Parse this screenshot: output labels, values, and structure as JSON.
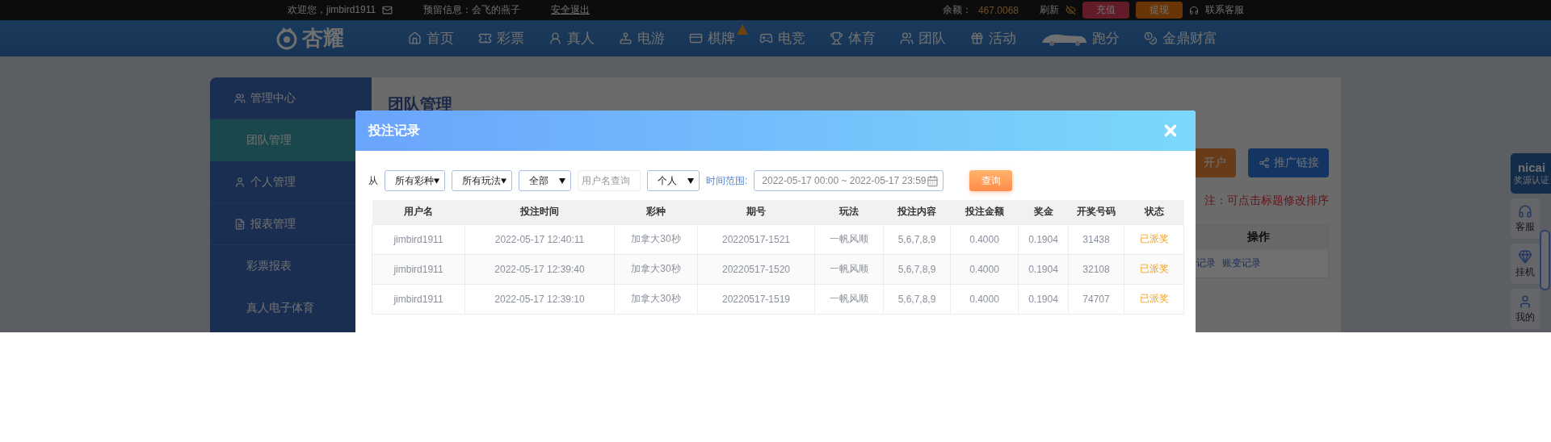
{
  "top_bar": {
    "welcome": "欢迎您，jimbird1911",
    "message": "预留信息：会飞的燕子",
    "logout": "安全退出",
    "balance_label": "余额：",
    "balance": "467.0068",
    "refresh": "刷新",
    "buttons": [
      {
        "label": "充值",
        "kind": "deposit"
      },
      {
        "label": "提现",
        "kind": "withdraw"
      }
    ],
    "support": "联系客服"
  },
  "nav": {
    "logo": "杏耀",
    "items": [
      {
        "label": "首页"
      },
      {
        "label": "彩票"
      },
      {
        "label": "真人"
      },
      {
        "label": "电游"
      },
      {
        "label": "棋牌"
      },
      {
        "label": "电竞"
      },
      {
        "label": "体育"
      },
      {
        "label": "团队"
      },
      {
        "label": "活动"
      },
      {
        "label": "跑分"
      },
      {
        "label": "金鼎财富"
      }
    ]
  },
  "sidebar": {
    "items": [
      {
        "kind": "group",
        "label": "管理中心",
        "selected": false
      },
      {
        "kind": "item",
        "label": "团队管理",
        "selected": true
      },
      {
        "kind": "group",
        "label": "个人管理",
        "selected": false
      },
      {
        "kind": "group",
        "label": "报表管理",
        "selected": false
      },
      {
        "kind": "item",
        "label": "彩票报表",
        "selected": false
      },
      {
        "kind": "item",
        "label": "真人电子体育",
        "selected": false
      }
    ]
  },
  "main": {
    "title": "团队管理",
    "buttons": [
      {
        "label": "开户",
        "kind": "register"
      },
      {
        "label": "推广链接",
        "kind": "share"
      }
    ],
    "note": "注：可点击标题修改排序",
    "table": {
      "column": "操作",
      "links": [
        "记录",
        "账变记录"
      ]
    }
  },
  "modal": {
    "title": "投注记录",
    "filters": {
      "from_label": "从",
      "selects": [
        "所有彩种",
        "所有玩法",
        "全部"
      ],
      "username_placeholder": "用户名查询",
      "scope": "个人",
      "time_label": "时间范围:",
      "time_range": "2022-05-17 00:00 ~ 2022-05-17 23:59",
      "search_button": "查询"
    },
    "table": {
      "columns": [
        "用户名",
        "投注时间",
        "彩种",
        "期号",
        "玩法",
        "投注内容",
        "投注金额",
        "奖金",
        "开奖号码",
        "状态"
      ],
      "rows": [
        [
          "jimbird1911",
          "2022-05-17 12:40:11",
          "加拿大30秒",
          "20220517-1521",
          "一帆风顺",
          "5,6,7,8,9",
          "0.4000",
          "0.1904",
          "31438",
          "已派奖"
        ],
        [
          "jimbird1911",
          "2022-05-17 12:39:40",
          "加拿大30秒",
          "20220517-1520",
          "一帆风顺",
          "5,6,7,8,9",
          "0.4000",
          "0.1904",
          "32108",
          "已派奖"
        ],
        [
          "jimbird1911",
          "2022-05-17 12:39:10",
          "加拿大30秒",
          "20220517-1519",
          "一帆风顺",
          "5,6,7,8,9",
          "0.4000",
          "0.1904",
          "74707",
          "已派奖"
        ]
      ]
    }
  },
  "float_tools": [
    {
      "kind": "badge",
      "label": "nicai",
      "caption": "奖源认证"
    },
    {
      "kind": "tool",
      "caption": "客服"
    },
    {
      "kind": "tool",
      "caption": "挂机"
    },
    {
      "kind": "tool",
      "caption": "我的"
    }
  ]
}
